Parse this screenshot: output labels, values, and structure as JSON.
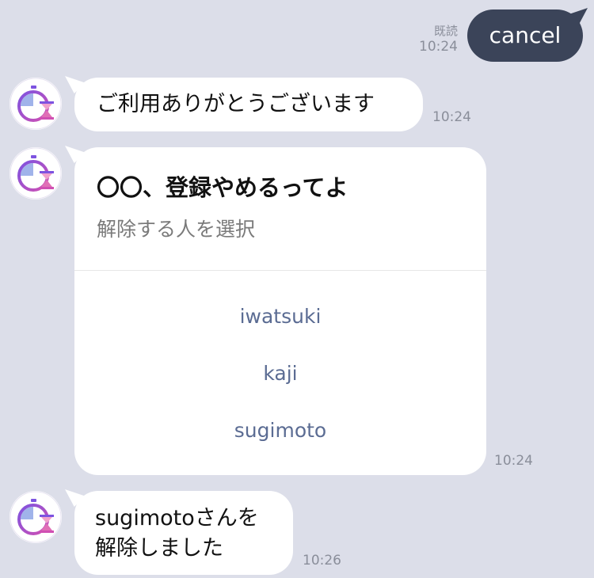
{
  "outgoing": {
    "read_label": "既読",
    "time": "10:24",
    "text": "cancel"
  },
  "messages": [
    {
      "text": "ご利用ありがとうございます",
      "time": "10:24"
    },
    {
      "card": {
        "title": "〇〇、登録やめるってよ",
        "subtitle": "解除する人を選択",
        "options": [
          "iwatsuki",
          "kaji",
          "sugimoto"
        ]
      },
      "time": "10:24"
    },
    {
      "line1": "sugimotoさんを",
      "line2": "解除しました",
      "time": "10:26"
    }
  ],
  "colors": {
    "background": "#dcdee9",
    "outgoing_bubble": "#3b4459",
    "option_link": "#5b6c93",
    "avatar_purple": "#7d53e0",
    "avatar_pink": "#d04fb3"
  },
  "icons": {
    "avatar": "stopwatch-hourglass-icon"
  }
}
